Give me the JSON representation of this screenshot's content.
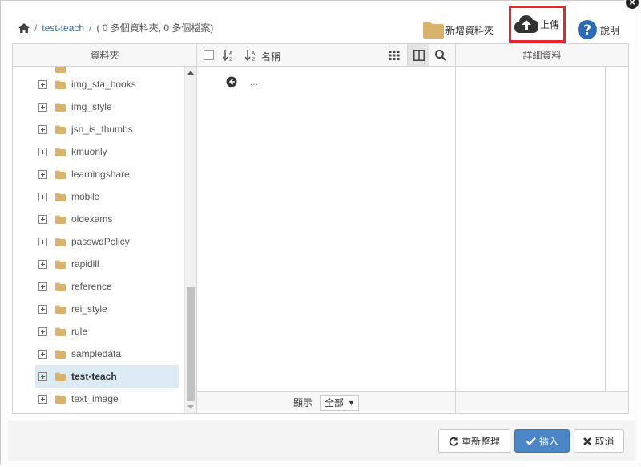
{
  "breadcrumb": {
    "current_folder": "test-teach",
    "summary": "( 0 多個資料夾, 0 多個檔案)",
    "separator": "/"
  },
  "toolbar": {
    "new_folder_label": "新增資料夾",
    "upload_label": "上傳",
    "help_label": "說明"
  },
  "columns": {
    "folders_header": "資料夾",
    "name_header": "名稱",
    "details_header": "詳細資料"
  },
  "tree": {
    "items": [
      {
        "label": "img_sta_books",
        "selected": false
      },
      {
        "label": "img_style",
        "selected": false
      },
      {
        "label": "jsn_is_thumbs",
        "selected": false
      },
      {
        "label": "kmuonly",
        "selected": false
      },
      {
        "label": "learningshare",
        "selected": false
      },
      {
        "label": "mobile",
        "selected": false
      },
      {
        "label": "oldexams",
        "selected": false
      },
      {
        "label": "passwdPolicy",
        "selected": false
      },
      {
        "label": "rapidill",
        "selected": false
      },
      {
        "label": "reference",
        "selected": false
      },
      {
        "label": "rei_style",
        "selected": false
      },
      {
        "label": "rule",
        "selected": false
      },
      {
        "label": "sampledata",
        "selected": false
      },
      {
        "label": "test-teach",
        "selected": true
      },
      {
        "label": "text_image",
        "selected": false
      }
    ]
  },
  "files": {
    "parent_label": "...",
    "show_label": "顯示",
    "show_value": "全部"
  },
  "footer": {
    "reload_label": "重新整理",
    "insert_label": "插入",
    "cancel_label": "取消"
  },
  "colors": {
    "accent": "#4a86c5",
    "link": "#2a6fb0",
    "folder": "#d9b36c",
    "highlight_box": "#e8242c",
    "selected_row": "#dbeaf3"
  }
}
